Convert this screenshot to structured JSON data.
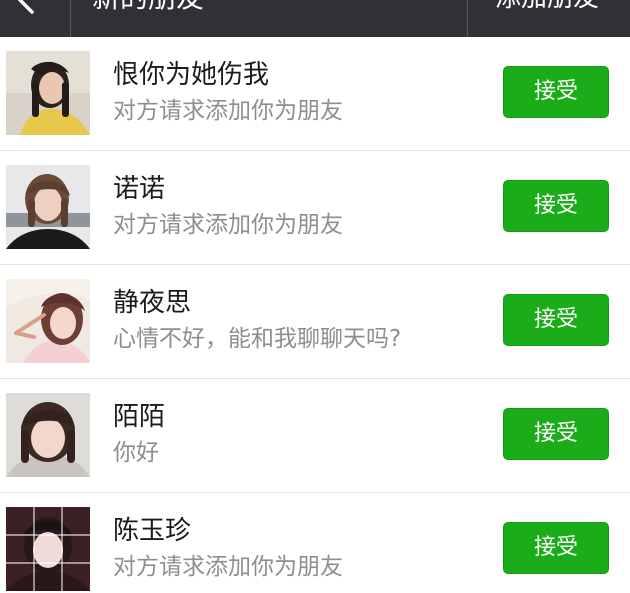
{
  "header": {
    "title": "新的朋友",
    "action_label": "添加朋友"
  },
  "requests": [
    {
      "name": "恨你为她伤我",
      "message": "对方请求添加你为朋友",
      "button": "接受"
    },
    {
      "name": "诺诺",
      "message": "对方请求添加你为朋友",
      "button": "接受"
    },
    {
      "name": "静夜思",
      "message": "心情不好，能和我聊聊天吗?",
      "button": "接受"
    },
    {
      "name": "陌陌",
      "message": "你好",
      "button": "接受"
    },
    {
      "name": "陈玉珍",
      "message": "对方请求添加你为朋友",
      "button": "接受"
    }
  ],
  "colors": {
    "navbar": "#2f3136",
    "accept_button": "#1aad19",
    "name_text": "#1b1b1b",
    "message_text": "#8e8e8e"
  }
}
